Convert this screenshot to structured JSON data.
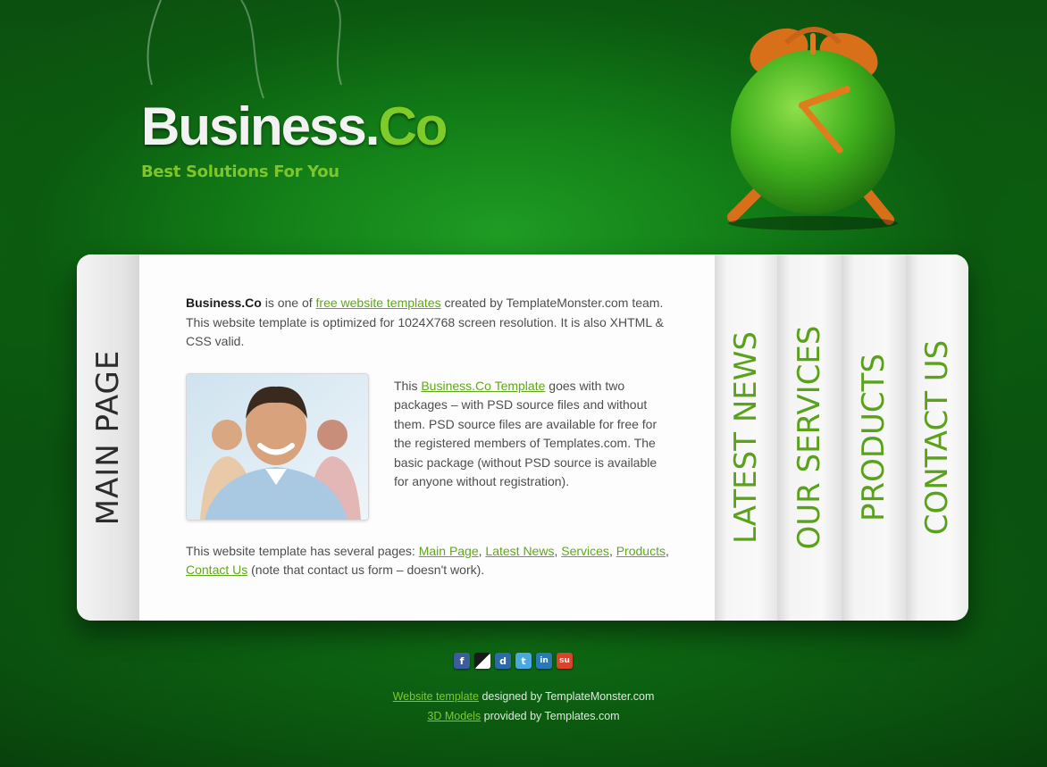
{
  "header": {
    "logo_main": "Business.",
    "logo_accent": "Co",
    "slogan": "Best Solutions For You"
  },
  "sidebar_left": {
    "label": "MAIN PAGE"
  },
  "content": {
    "p1": {
      "brand": "Business.Co",
      "t1": " is one of ",
      "link": "free website templates",
      "t2": " created by TemplateMonster.com team. This website template is optimized for 1024X768 screen resolution. It is also XHTML & CSS valid."
    },
    "p2": {
      "t1": "This ",
      "link": "Business.Co Template",
      "t2": " goes with two packages – with PSD source files and without them. PSD source files are available for free for the registered members of Templates.com. The basic package (without PSD source is available for anyone without registration)."
    },
    "p3": {
      "t1": "This website template has several pages: ",
      "links": [
        "Main Page",
        "Latest News",
        "Services",
        "Products",
        "Contact Us"
      ],
      "sep": ", ",
      "t2": " (note that contact us form – doesn't work)."
    }
  },
  "nav": {
    "items": [
      {
        "label": "LATEST NEWS"
      },
      {
        "label": "OUR SERVICES"
      },
      {
        "label": "PRODUCTS"
      },
      {
        "label": "CONTACT US"
      }
    ]
  },
  "social": {
    "icons": [
      {
        "name": "facebook-icon",
        "glyph": "f",
        "color": "#3b5d9c"
      },
      {
        "name": "delicious-icon",
        "glyph": "",
        "color": "#1a1a1a"
      },
      {
        "name": "digg-icon",
        "glyph": "d",
        "color": "#2c6aa8"
      },
      {
        "name": "twitter-icon",
        "glyph": "t",
        "color": "#4aa8e0"
      },
      {
        "name": "linkedin-icon",
        "glyph": "in",
        "color": "#2a78b4"
      },
      {
        "name": "stumbleupon-icon",
        "glyph": "su",
        "color": "#d9432a"
      }
    ]
  },
  "footer": {
    "line1_link": "Website template",
    "line1_text": " designed by TemplateMonster.com",
    "line2_link": "3D Models",
    "line2_text": " provided by Templates.com"
  },
  "colors": {
    "accent_green": "#7ecb2a",
    "link_green": "#5fa816",
    "background_green": "#127d17"
  }
}
